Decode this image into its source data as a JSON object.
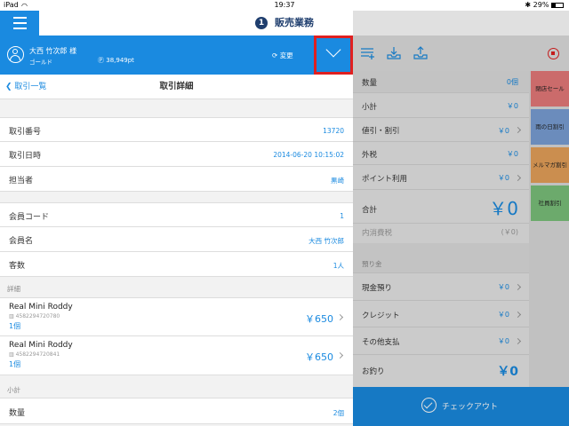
{
  "status_bar": {
    "device": "iPad",
    "wifi_icon": "wifi-icon",
    "time": "19:37",
    "battery": "29%"
  },
  "nav": {
    "step": "1",
    "title": "販売業務"
  },
  "member": {
    "name": "大西 竹次郎 様",
    "rank": "ゴールド",
    "points": "38,949pt",
    "change_label": "変更"
  },
  "detail": {
    "back_label": "取引一覧",
    "title": "取引詳細",
    "rows1": [
      {
        "label": "取引番号",
        "value": "13720"
      },
      {
        "label": "取引日時",
        "value": "2014-06-20 10:15:02"
      },
      {
        "label": "担当者",
        "value": "黒崎"
      }
    ],
    "rows2": [
      {
        "label": "会員コード",
        "value": "1"
      },
      {
        "label": "会員名",
        "value": "大西 竹次郎"
      },
      {
        "label": "客数",
        "value": "1人"
      }
    ],
    "section_detail": "詳細",
    "items": [
      {
        "name": "Real Mini Roddy",
        "code": "4582294720780",
        "qty": "1個",
        "price": "￥650"
      },
      {
        "name": "Real Mini Roddy",
        "code": "4582294720841",
        "qty": "1個",
        "price": "￥650"
      }
    ],
    "section_subtotal": "小計",
    "qty_label": "数量",
    "qty_value": "2個"
  },
  "summary": {
    "rows": [
      {
        "label": "数量",
        "value": "0個"
      },
      {
        "label": "小計",
        "value": "￥0"
      },
      {
        "label": "値引・割引",
        "value": "￥0"
      },
      {
        "label": "外税",
        "value": "￥0"
      },
      {
        "label": "ポイント利用",
        "value": "￥0"
      }
    ],
    "total_label": "合計",
    "total_value": "￥0",
    "inner_tax_label": "内消費税",
    "inner_tax_value": "(￥0)",
    "deposit_section": "預り金",
    "payments": [
      {
        "label": "現金預り",
        "value": "￥0"
      },
      {
        "label": "クレジット",
        "value": "￥0"
      },
      {
        "label": "その他支払",
        "value": "￥0"
      }
    ],
    "change_label": "お釣り",
    "change_value": "￥0"
  },
  "side_tabs": [
    {
      "label": "閉店セール",
      "color": "#e87a7a"
    },
    {
      "label": "雨の日割引",
      "color": "#7aa0d6"
    },
    {
      "label": "メルマガ割引",
      "color": "#e8a25a"
    },
    {
      "label": "社員割引",
      "color": "#7cc27c"
    }
  ],
  "checkout_label": "チェックアウト",
  "colors": {
    "accent": "#1a8ae0",
    "nav_dark": "#1f3e6e",
    "highlight_border": "#e02020"
  }
}
